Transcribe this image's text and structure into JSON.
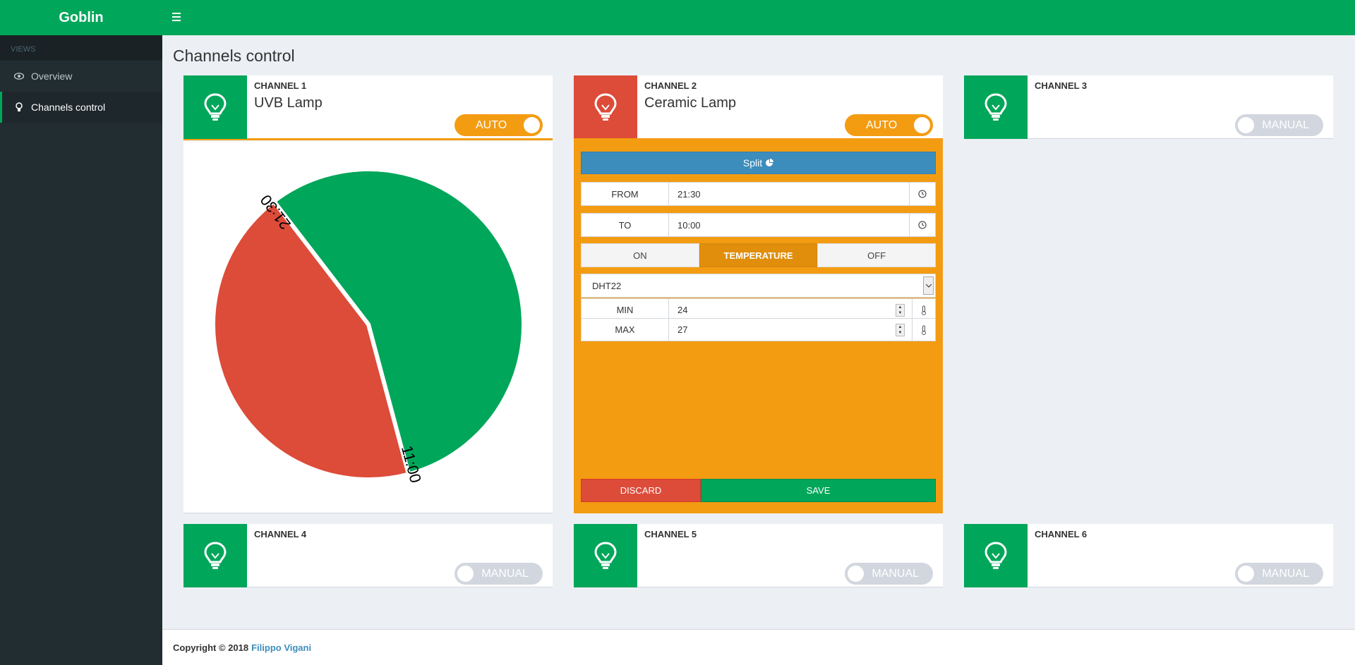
{
  "app": {
    "title": "Goblin"
  },
  "sidebar": {
    "header": "VIEWS",
    "items": [
      {
        "label": "Overview",
        "icon": "eye-icon"
      },
      {
        "label": "Channels control",
        "icon": "lightbulb-icon",
        "active": true
      }
    ]
  },
  "page": {
    "title": "Channels control"
  },
  "channels": [
    {
      "label": "CHANNEL 1",
      "name": "UVB Lamp",
      "mode": "AUTO",
      "tile_color": "#00a65a"
    },
    {
      "label": "CHANNEL 2",
      "name": "Ceramic Lamp",
      "mode": "AUTO",
      "tile_color": "#dd4b39"
    },
    {
      "label": "CHANNEL 3",
      "name": "",
      "mode": "MANUAL",
      "tile_color": "#00a65a"
    },
    {
      "label": "CHANNEL 4",
      "name": "",
      "mode": "MANUAL",
      "tile_color": "#00a65a"
    },
    {
      "label": "CHANNEL 5",
      "name": "",
      "mode": "MANUAL",
      "tile_color": "#00a65a"
    },
    {
      "label": "CHANNEL 6",
      "name": "",
      "mode": "MANUAL",
      "tile_color": "#00a65a"
    }
  ],
  "chart_data": {
    "type": "pie",
    "slices": [
      {
        "from": "21:30",
        "to": "11:00",
        "color": "#00a65a"
      },
      {
        "from": "11:00",
        "to": "21:30",
        "color": "#dd4b39"
      }
    ],
    "labels": [
      "21:30",
      "11:00"
    ]
  },
  "editor": {
    "split_label": "Split",
    "from": {
      "label": "FROM",
      "value": "21:30"
    },
    "to": {
      "label": "TO",
      "value": "10:00"
    },
    "modes": [
      "ON",
      "TEMPERATURE",
      "OFF"
    ],
    "active_mode": "TEMPERATURE",
    "sensor": "DHT22",
    "min": {
      "label": "MIN",
      "value": "24"
    },
    "max": {
      "label": "MAX",
      "value": "27"
    },
    "discard_label": "DISCARD",
    "save_label": "SAVE"
  },
  "footer": {
    "copyright": "Copyright © 2018",
    "author": "Filippo Vigani"
  },
  "colors": {
    "green": "#00a65a",
    "orange": "#f39c12",
    "red": "#dd4b39",
    "blue": "#3c8dbc",
    "sidebar": "#222d32"
  }
}
